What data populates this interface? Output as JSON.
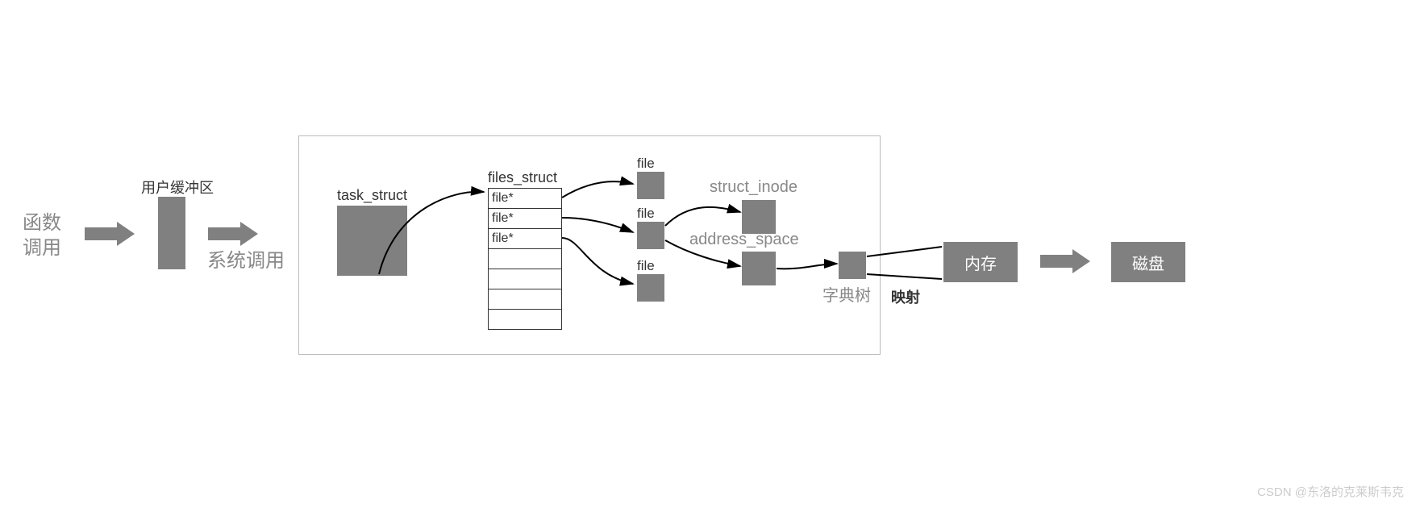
{
  "left_label": "函数\n调用",
  "user_buffer_label": "用户缓冲区",
  "syscall_label": "系统调用",
  "task_struct_label": "task_struct",
  "files_struct_label": "files_struct",
  "table_rows": [
    "file*",
    "file*",
    "file*",
    "",
    "",
    "",
    ""
  ],
  "file_labels": [
    "file",
    "file",
    "file"
  ],
  "struct_inode_label": "struct_inode",
  "address_space_label": "address_space",
  "dict_tree_label": "字典树",
  "mapping_label": "映射",
  "memory_label": "内存",
  "disk_label": "磁盘",
  "watermark": "CSDN @东洛的克莱斯韦克"
}
